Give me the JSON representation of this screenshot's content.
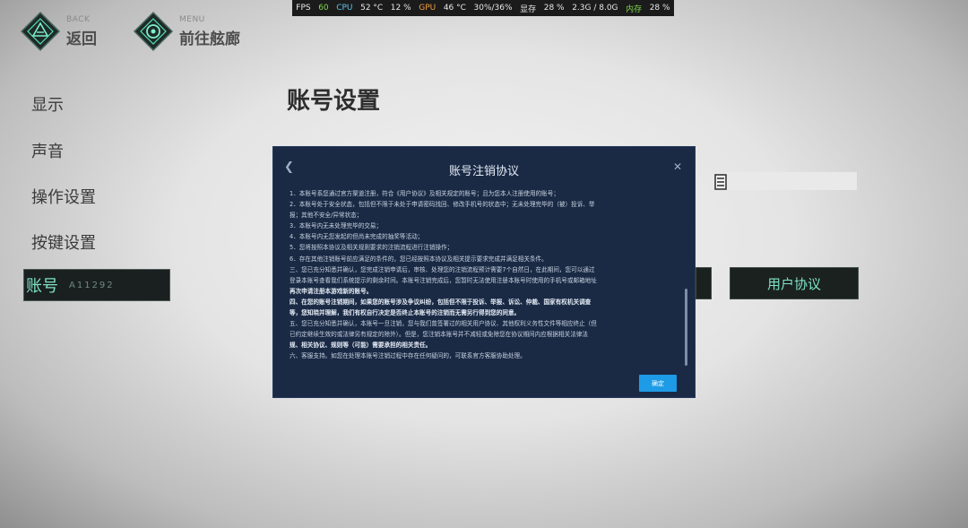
{
  "perf": {
    "fps_label": "FPS",
    "fps_value": "60",
    "cpu_label": "CPU",
    "cpu_temp": "52 °C",
    "cpu_usage": "12 %",
    "gpu_label": "GPU",
    "gpu_temp": "46 °C",
    "gpu_usage": "30%/36%",
    "vram_label": "显存",
    "vram_usage": "28 %",
    "vram_amount": "2.3G / 8.0G",
    "mem_label": "内存",
    "mem_usage": "28 %",
    "colors": {
      "fps": "#7dd94a",
      "cpu": "#5ec3e8",
      "gpu": "#f0a040",
      "mem": "#7dd94a"
    }
  },
  "nav": {
    "back_sub": "BACK",
    "back_label": "返回",
    "menu_sub": "MENU",
    "menu_label": "前往舷廊"
  },
  "sidebar": {
    "items": [
      {
        "label": "显示"
      },
      {
        "label": "声音"
      },
      {
        "label": "操作设置"
      },
      {
        "label": "按键设置"
      }
    ],
    "active": {
      "label": "账号",
      "id": "A11292"
    }
  },
  "page": {
    "title": "账号设置"
  },
  "background": {
    "user_agreement_label": "用户协议"
  },
  "modal": {
    "title": "账号注销协议",
    "confirm_label": "确定",
    "lines": [
      {
        "text": "1．本账号系您通过官方渠道注册，符合《用户协议》及相关规定的账号；且为您本人注册使用的账号；",
        "bold": false
      },
      {
        "text": "2．本账号处于安全状态，包括但不限于未处于申请密码找回、修改手机号的状态中；无未处理完毕的（被）投诉、举",
        "bold": false
      },
      {
        "text": "报；其他不安全/异常状态；",
        "bold": false
      },
      {
        "text": "3．本账号内无未处理完毕的交易；",
        "bold": false
      },
      {
        "text": "4．本账号内无您发起的但尚未完成的抽奖等活动；",
        "bold": false
      },
      {
        "text": "5．您将按照本协议及相关规则要求的注销流程进行注销操作；",
        "bold": false
      },
      {
        "text": "6．存在其他注销账号前应满足的条件的，您已经按照本协议及相关提示要求完成并满足相关条件。",
        "bold": false
      },
      {
        "text": "三、您已充分知悉并确认，您完成注销申请后，审核、处理您的注销流程预计需要7个自然日，在此期间，您可以通过",
        "bold": false
      },
      {
        "text": "登录本账号查看我们系统提示的剩余时间。本账号注销完成后，您暂时无法使用注册本账号时使用的手机号或邮箱地址",
        "bold": false
      },
      {
        "text": "再次申请注册本游戏新的账号。",
        "bold": true
      },
      {
        "text": "四、在您的账号注销期间，如果您的账号涉及争议纠纷，包括但不限于投诉、举报、诉讼、仲裁、国家有权机关调查",
        "bold": true
      },
      {
        "text": "等，您知晓并理解，我们有权自行决定是否终止本账号的注销而无需另行得到您的同意。",
        "bold": true
      },
      {
        "text": "五、您已充分知悉并确认，本账号一旦注销，您与我们曾签署过的相关用户协议、其他权利义务性文件等相应终止（但",
        "bold": false
      },
      {
        "text": "已约定继续生效的或法律另有规定的除外）。但是，您注销本账号并不减轻或免除您在协议期间内应根据相关法律法",
        "bold": false
      },
      {
        "text": "规、相关协议、规则等（可能）需要承担的相关责任。",
        "bold": true
      },
      {
        "text": "六、客服支持。如您在处理本账号注销过程中存在任何疑问的，可联系官方客服协助处理。",
        "bold": false
      }
    ]
  }
}
